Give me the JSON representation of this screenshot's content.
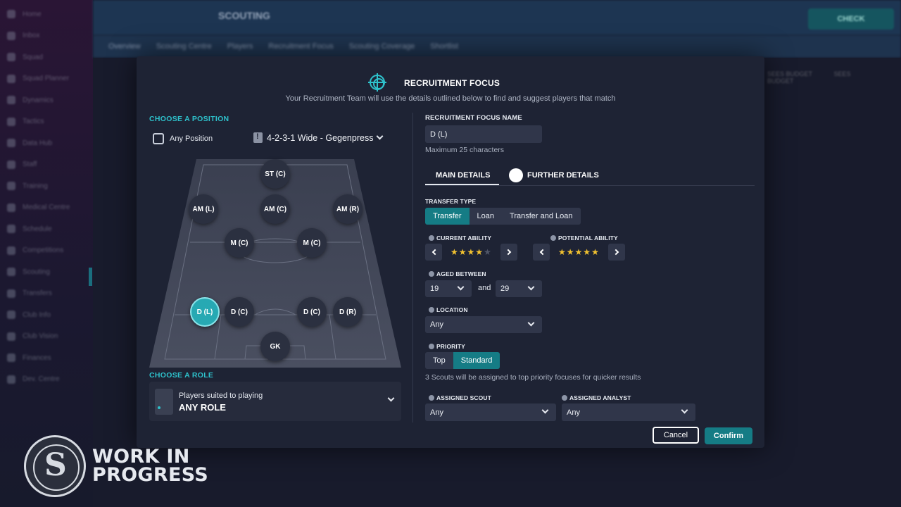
{
  "background": {
    "title": "SCOUTING",
    "continue_label": "CHECK",
    "tabs": [
      "Overview",
      "Scouting Centre",
      "Players",
      "Recruitment Focus",
      "Scouting Coverage",
      "Shortlist"
    ],
    "sidebar": [
      "Home",
      "Inbox",
      "Squad",
      "Squad Planner",
      "Dynamics",
      "Tactics",
      "Data Hub",
      "Staff",
      "Training",
      "Medical Centre",
      "Schedule",
      "Competitions",
      "Scouting",
      "Transfers",
      "Club Info",
      "Club Vision",
      "Finances",
      "Dev. Centre"
    ],
    "strip": [
      "SEES BUDGET",
      "SEES BUDGET"
    ]
  },
  "modal": {
    "title": "RECRUITMENT FOCUS",
    "subtitle": "Your Recruitment Team will use the details outlined below to find and suggest players that match",
    "icon": "crosshair-icon"
  },
  "position": {
    "section_label": "CHOOSE A POSITION",
    "any_position_label": "Any Position",
    "any_position_checked": false,
    "formation": "4-2-3-1 Wide - Gegenpress",
    "players": [
      {
        "label": "ST (C)",
        "active": false
      },
      {
        "label": "AM (L)",
        "active": false
      },
      {
        "label": "AM (C)",
        "active": false
      },
      {
        "label": "AM (R)",
        "active": false
      },
      {
        "label": "M (C)",
        "active": false
      },
      {
        "label": "M (C)",
        "active": false
      },
      {
        "label": "D (L)",
        "active": true
      },
      {
        "label": "D (C)",
        "active": false
      },
      {
        "label": "D (C)",
        "active": false
      },
      {
        "label": "D (R)",
        "active": false
      },
      {
        "label": "GK",
        "active": false
      }
    ]
  },
  "role": {
    "section_label": "CHOOSE A ROLE",
    "subtitle": "Players suited to playing",
    "value": "ANY ROLE"
  },
  "focus": {
    "name_label": "RECRUITMENT FOCUS NAME",
    "name_value": "D (L)",
    "name_hint": "Maximum 25 characters",
    "tabs": [
      "MAIN DETAILS",
      "FURTHER DETAILS"
    ],
    "active_tab": "MAIN DETAILS",
    "transfer_type_label": "TRANSFER TYPE",
    "transfer_types": [
      "Transfer",
      "Loan",
      "Transfer and Loan"
    ],
    "transfer_selected": "Transfer",
    "current_ability_label": "CURRENT ABILITY",
    "current_ability_stars": 4,
    "potential_ability_label": "POTENTIAL ABILITY",
    "potential_ability_stars": 5,
    "max_stars": 5,
    "aged_between_label": "AGED BETWEEN",
    "age_min": "19",
    "age_and": "and",
    "age_max": "29",
    "location_label": "LOCATION",
    "location_value": "Any",
    "priority_label": "PRIORITY",
    "priority_options": [
      "Top",
      "Standard"
    ],
    "priority_selected": "Standard",
    "priority_hint": "3 Scouts will be assigned to top priority focuses for quicker results",
    "assigned_scout_label": "ASSIGNED SCOUT",
    "assigned_scout_value": "Any",
    "assigned_analyst_label": "ASSIGNED ANALYST",
    "assigned_analyst_value": "Any"
  },
  "actions": {
    "cancel": "Cancel",
    "confirm": "Confirm"
  },
  "watermark": {
    "line1": "WORK IN",
    "line2": "PROGRESS",
    "logo_letter": "S"
  },
  "colors": {
    "accent": "#2ec2cc",
    "selected": "#157c85",
    "star": "#f2c230"
  }
}
